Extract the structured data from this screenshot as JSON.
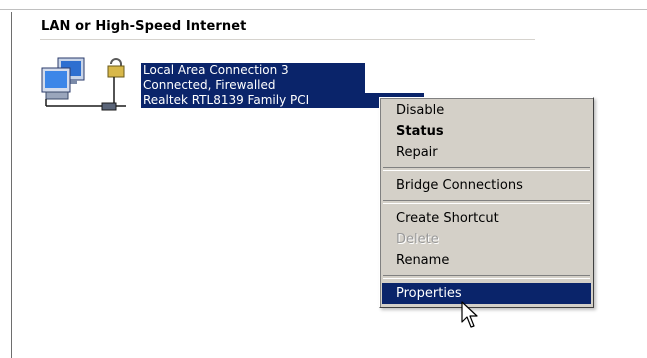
{
  "group": {
    "title": "LAN or High-Speed Internet"
  },
  "connection": {
    "name": "Local Area Connection 3",
    "status": "Connected, Firewalled",
    "device": "Realtek RTL8139 Family PCI",
    "icon": "network-connection-icon"
  },
  "context_menu": {
    "items": [
      {
        "label": "Disable"
      },
      {
        "label": "Status",
        "default": true
      },
      {
        "label": "Repair"
      },
      {
        "label": "Bridge Connections"
      },
      {
        "label": "Create Shortcut"
      },
      {
        "label": "Delete",
        "disabled": true
      },
      {
        "label": "Rename"
      },
      {
        "label": "Properties",
        "selected": true
      }
    ]
  },
  "colors": {
    "selection": "#0a246a",
    "menu_background": "#d4d0c8",
    "disabled_text": "#9a9a9a"
  }
}
